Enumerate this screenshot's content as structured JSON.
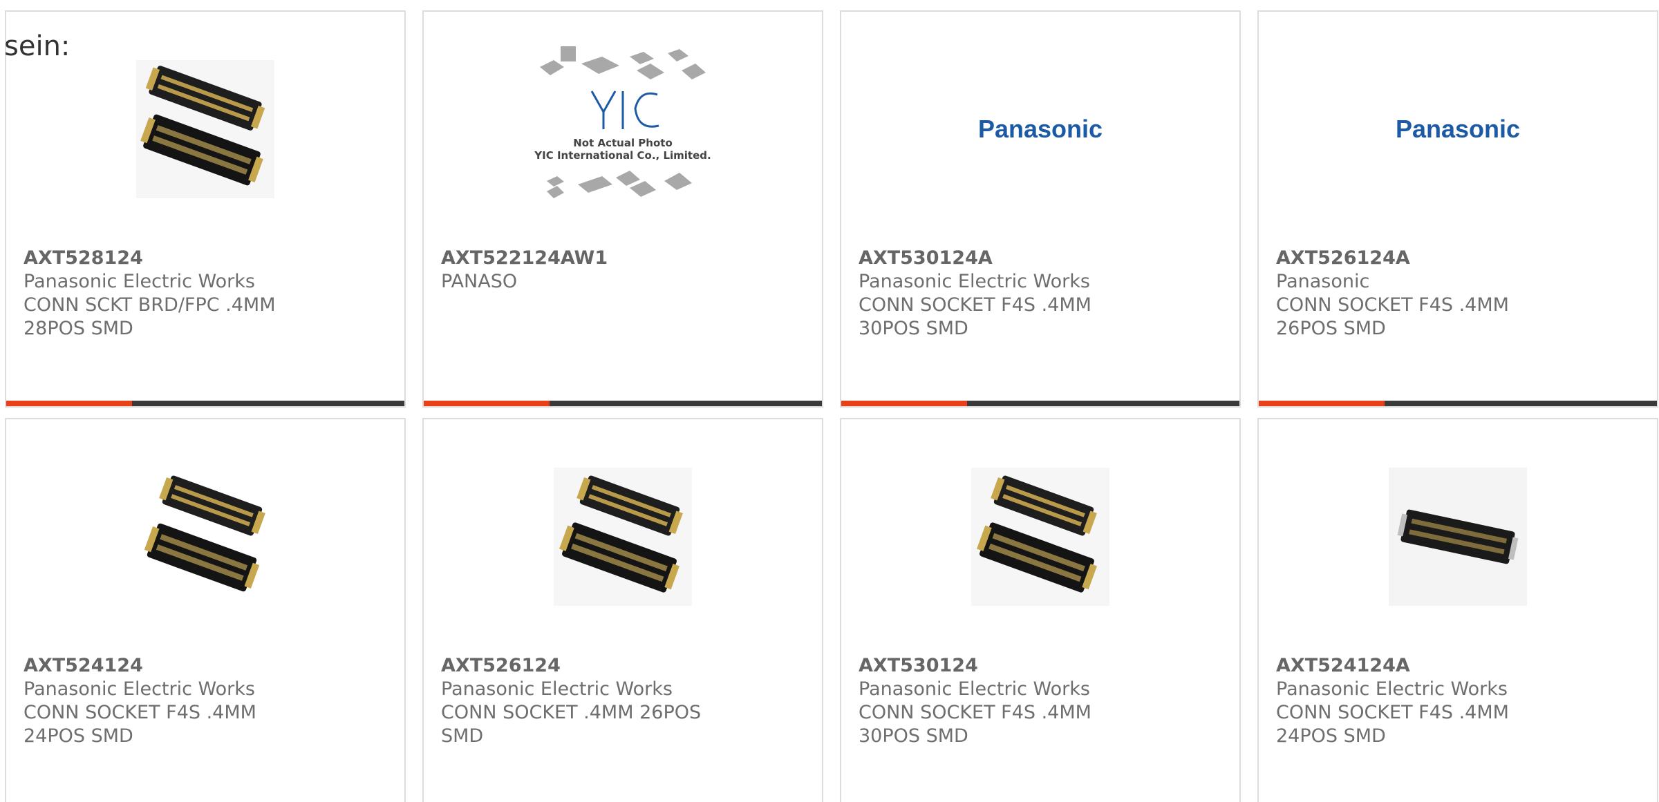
{
  "intro_text": "sein:",
  "colors": {
    "accent": "#e8411a",
    "bar_dark": "#3a3a3a",
    "text": "#6e6e6e",
    "panasonic_blue": "#1d5aa6"
  },
  "products": [
    {
      "part_number": "AXT528124",
      "manufacturer": "Panasonic Electric Works",
      "description": "CONN SCKT BRD/FPC .4MM 28POS SMD",
      "image": "connector-pair-photo"
    },
    {
      "part_number": "AXT522124AW1",
      "manufacturer": "PANASO",
      "description": "",
      "image": "placeholder-not-actual-photo",
      "placeholder_text": {
        "logo": "YIC",
        "line1": "Not Actual Photo",
        "line2": "YIC International Co., Limited."
      }
    },
    {
      "part_number": "AXT530124A",
      "manufacturer": "Panasonic Electric Works",
      "description": "CONN SOCKET F4S .4MM 30POS SMD",
      "image": "panasonic-logo",
      "logo_text": "Panasonic"
    },
    {
      "part_number": "AXT526124A",
      "manufacturer": "Panasonic",
      "description": "CONN SOCKET F4S .4MM 26POS SMD",
      "image": "panasonic-logo",
      "logo_text": "Panasonic"
    },
    {
      "part_number": "AXT524124",
      "manufacturer": "Panasonic Electric Works",
      "description": "CONN SOCKET F4S .4MM 24POS SMD",
      "image": "connector-pair-photo"
    },
    {
      "part_number": "AXT526124",
      "manufacturer": "Panasonic Electric Works",
      "description": "CONN SOCKET .4MM 26POS SMD",
      "image": "connector-pair-photo"
    },
    {
      "part_number": "AXT530124",
      "manufacturer": "Panasonic Electric Works",
      "description": "CONN SOCKET F4S .4MM 30POS SMD",
      "image": "connector-pair-photo"
    },
    {
      "part_number": "AXT524124A",
      "manufacturer": "Panasonic Electric Works",
      "description": "CONN SOCKET F4S .4MM 24POS SMD",
      "image": "connector-single-photo"
    }
  ]
}
